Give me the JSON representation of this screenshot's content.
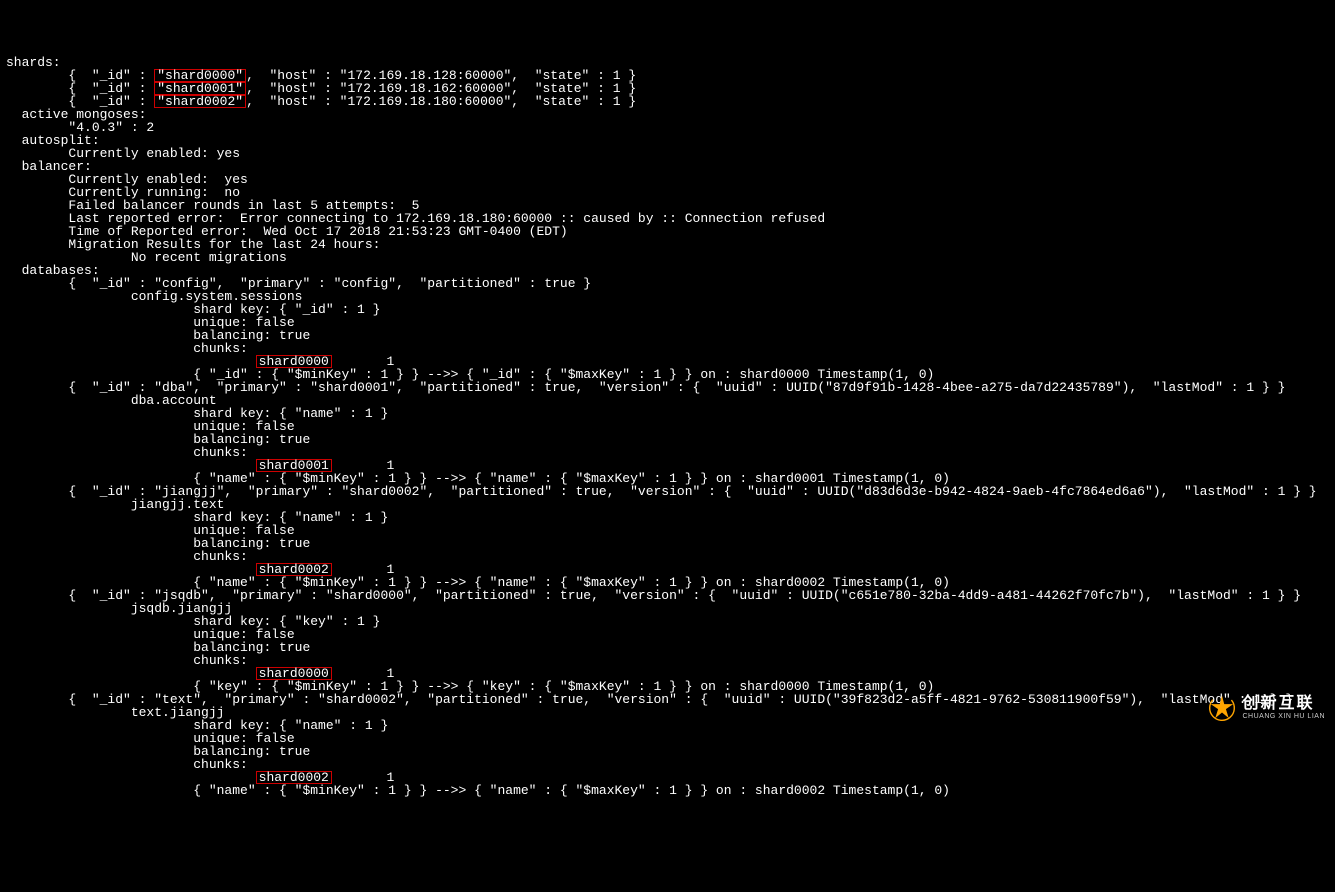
{
  "header": {
    "shards": "shards:",
    "shard0_pre": "        {  \"_id\" : ",
    "shard0_id": "\"shard0000\"",
    "shard0_rest": ",  \"host\" : \"172.169.18.128:60000\",  \"state\" : 1 }",
    "shard1_pre": "        {  \"_id\" : ",
    "shard1_id": "\"shard0001\"",
    "shard1_rest": ",  \"host\" : \"172.169.18.162:60000\",  \"state\" : 1 }",
    "shard2_pre": "        {  \"_id\" : ",
    "shard2_id": "\"shard0002\"",
    "shard2_rest": ",  \"host\" : \"172.169.18.180:60000\",  \"state\" : 1 }",
    "active_mongoses": "  active mongoses:",
    "version": "        \"4.0.3\" : 2",
    "autosplit": "  autosplit:",
    "autosplit_enabled": "        Currently enabled: yes",
    "balancer": "  balancer:",
    "balancer_enabled": "        Currently enabled:  yes",
    "balancer_running": "        Currently running:  no",
    "balancer_failed": "        Failed balancer rounds in last 5 attempts:  5",
    "balancer_last_err": "        Last reported error:  Error connecting to 172.169.18.180:60000 :: caused by :: Connection refused",
    "balancer_err_time": "        Time of Reported error:  Wed Oct 17 2018 21:53:23 GMT-0400 (EDT)",
    "migration": "        Migration Results for the last 24 hours:",
    "no_migrations": "                No recent migrations",
    "databases": "  databases:"
  },
  "db": {
    "config": {
      "line": "        {  \"_id\" : \"config\",  \"primary\" : \"config\",  \"partitioned\" : true }",
      "coll": "                config.system.sessions",
      "shardkey": "                        shard key: { \"_id\" : 1 }",
      "unique": "                        unique: false",
      "balancing": "                        balancing: true",
      "chunks": "                        chunks:",
      "chunk_shard_pre": "                                ",
      "chunk_shard": "shard0000",
      "chunk_shard_post": "       1",
      "chunk_range": "                        { \"_id\" : { \"$minKey\" : 1 } } -->> { \"_id\" : { \"$maxKey\" : 1 } } on : shard0000 Timestamp(1, 0)"
    },
    "dba": {
      "line": "        {  \"_id\" : \"dba\",  \"primary\" : \"shard0001\",  \"partitioned\" : true,  \"version\" : {  \"uuid\" : UUID(\"87d9f91b-1428-4bee-a275-da7d22435789\"),  \"lastMod\" : 1 } }",
      "coll": "                dba.account",
      "shardkey": "                        shard key: { \"name\" : 1 }",
      "unique": "                        unique: false",
      "balancing": "                        balancing: true",
      "chunks": "                        chunks:",
      "chunk_shard_pre": "                                ",
      "chunk_shard": "shard0001",
      "chunk_shard_post": "       1",
      "chunk_range": "                        { \"name\" : { \"$minKey\" : 1 } } -->> { \"name\" : { \"$maxKey\" : 1 } } on : shard0001 Timestamp(1, 0)"
    },
    "jiangjj": {
      "line": "        {  \"_id\" : \"jiangjj\",  \"primary\" : \"shard0002\",  \"partitioned\" : true,  \"version\" : {  \"uuid\" : UUID(\"d83d6d3e-b942-4824-9aeb-4fc7864ed6a6\"),  \"lastMod\" : 1 } }",
      "coll": "                jiangjj.text",
      "shardkey": "                        shard key: { \"name\" : 1 }",
      "unique": "                        unique: false",
      "balancing": "                        balancing: true",
      "chunks": "                        chunks:",
      "chunk_shard_pre": "                                ",
      "chunk_shard": "shard0002",
      "chunk_shard_post": "       1",
      "chunk_range": "                        { \"name\" : { \"$minKey\" : 1 } } -->> { \"name\" : { \"$maxKey\" : 1 } } on : shard0002 Timestamp(1, 0)"
    },
    "jsqdb": {
      "line": "        {  \"_id\" : \"jsqdb\",  \"primary\" : \"shard0000\",  \"partitioned\" : true,  \"version\" : {  \"uuid\" : UUID(\"c651e780-32ba-4dd9-a481-44262f70fc7b\"),  \"lastMod\" : 1 } }",
      "coll": "                jsqdb.jiangjj",
      "shardkey": "                        shard key: { \"key\" : 1 }",
      "unique": "                        unique: false",
      "balancing": "                        balancing: true",
      "chunks": "                        chunks:",
      "chunk_shard_pre": "                                ",
      "chunk_shard": "shard0000",
      "chunk_shard_post": "       1",
      "chunk_range": "                        { \"key\" : { \"$minKey\" : 1 } } -->> { \"key\" : { \"$maxKey\" : 1 } } on : shard0000 Timestamp(1, 0)"
    },
    "text": {
      "line": "        {  \"_id\" : \"text\",  \"primary\" : \"shard0002\",  \"partitioned\" : true,  \"version\" : {  \"uuid\" : UUID(\"39f823d2-a5ff-4821-9762-530811900f59\"),  \"lastMod\" : 1 } }",
      "coll": "                text.jiangjj",
      "shardkey": "                        shard key: { \"name\" : 1 }",
      "unique": "                        unique: false",
      "balancing": "                        balancing: true",
      "chunks": "                        chunks:",
      "chunk_shard_pre": "                                ",
      "chunk_shard": "shard0002",
      "chunk_shard_post": "       1",
      "chunk_range": "                        { \"name\" : { \"$minKey\" : 1 } } -->> { \"name\" : { \"$maxKey\" : 1 } } on : shard0002 Timestamp(1, 0)"
    }
  },
  "logo": {
    "cn": "创新互联",
    "en": "CHUANG XIN HU LIAN"
  }
}
